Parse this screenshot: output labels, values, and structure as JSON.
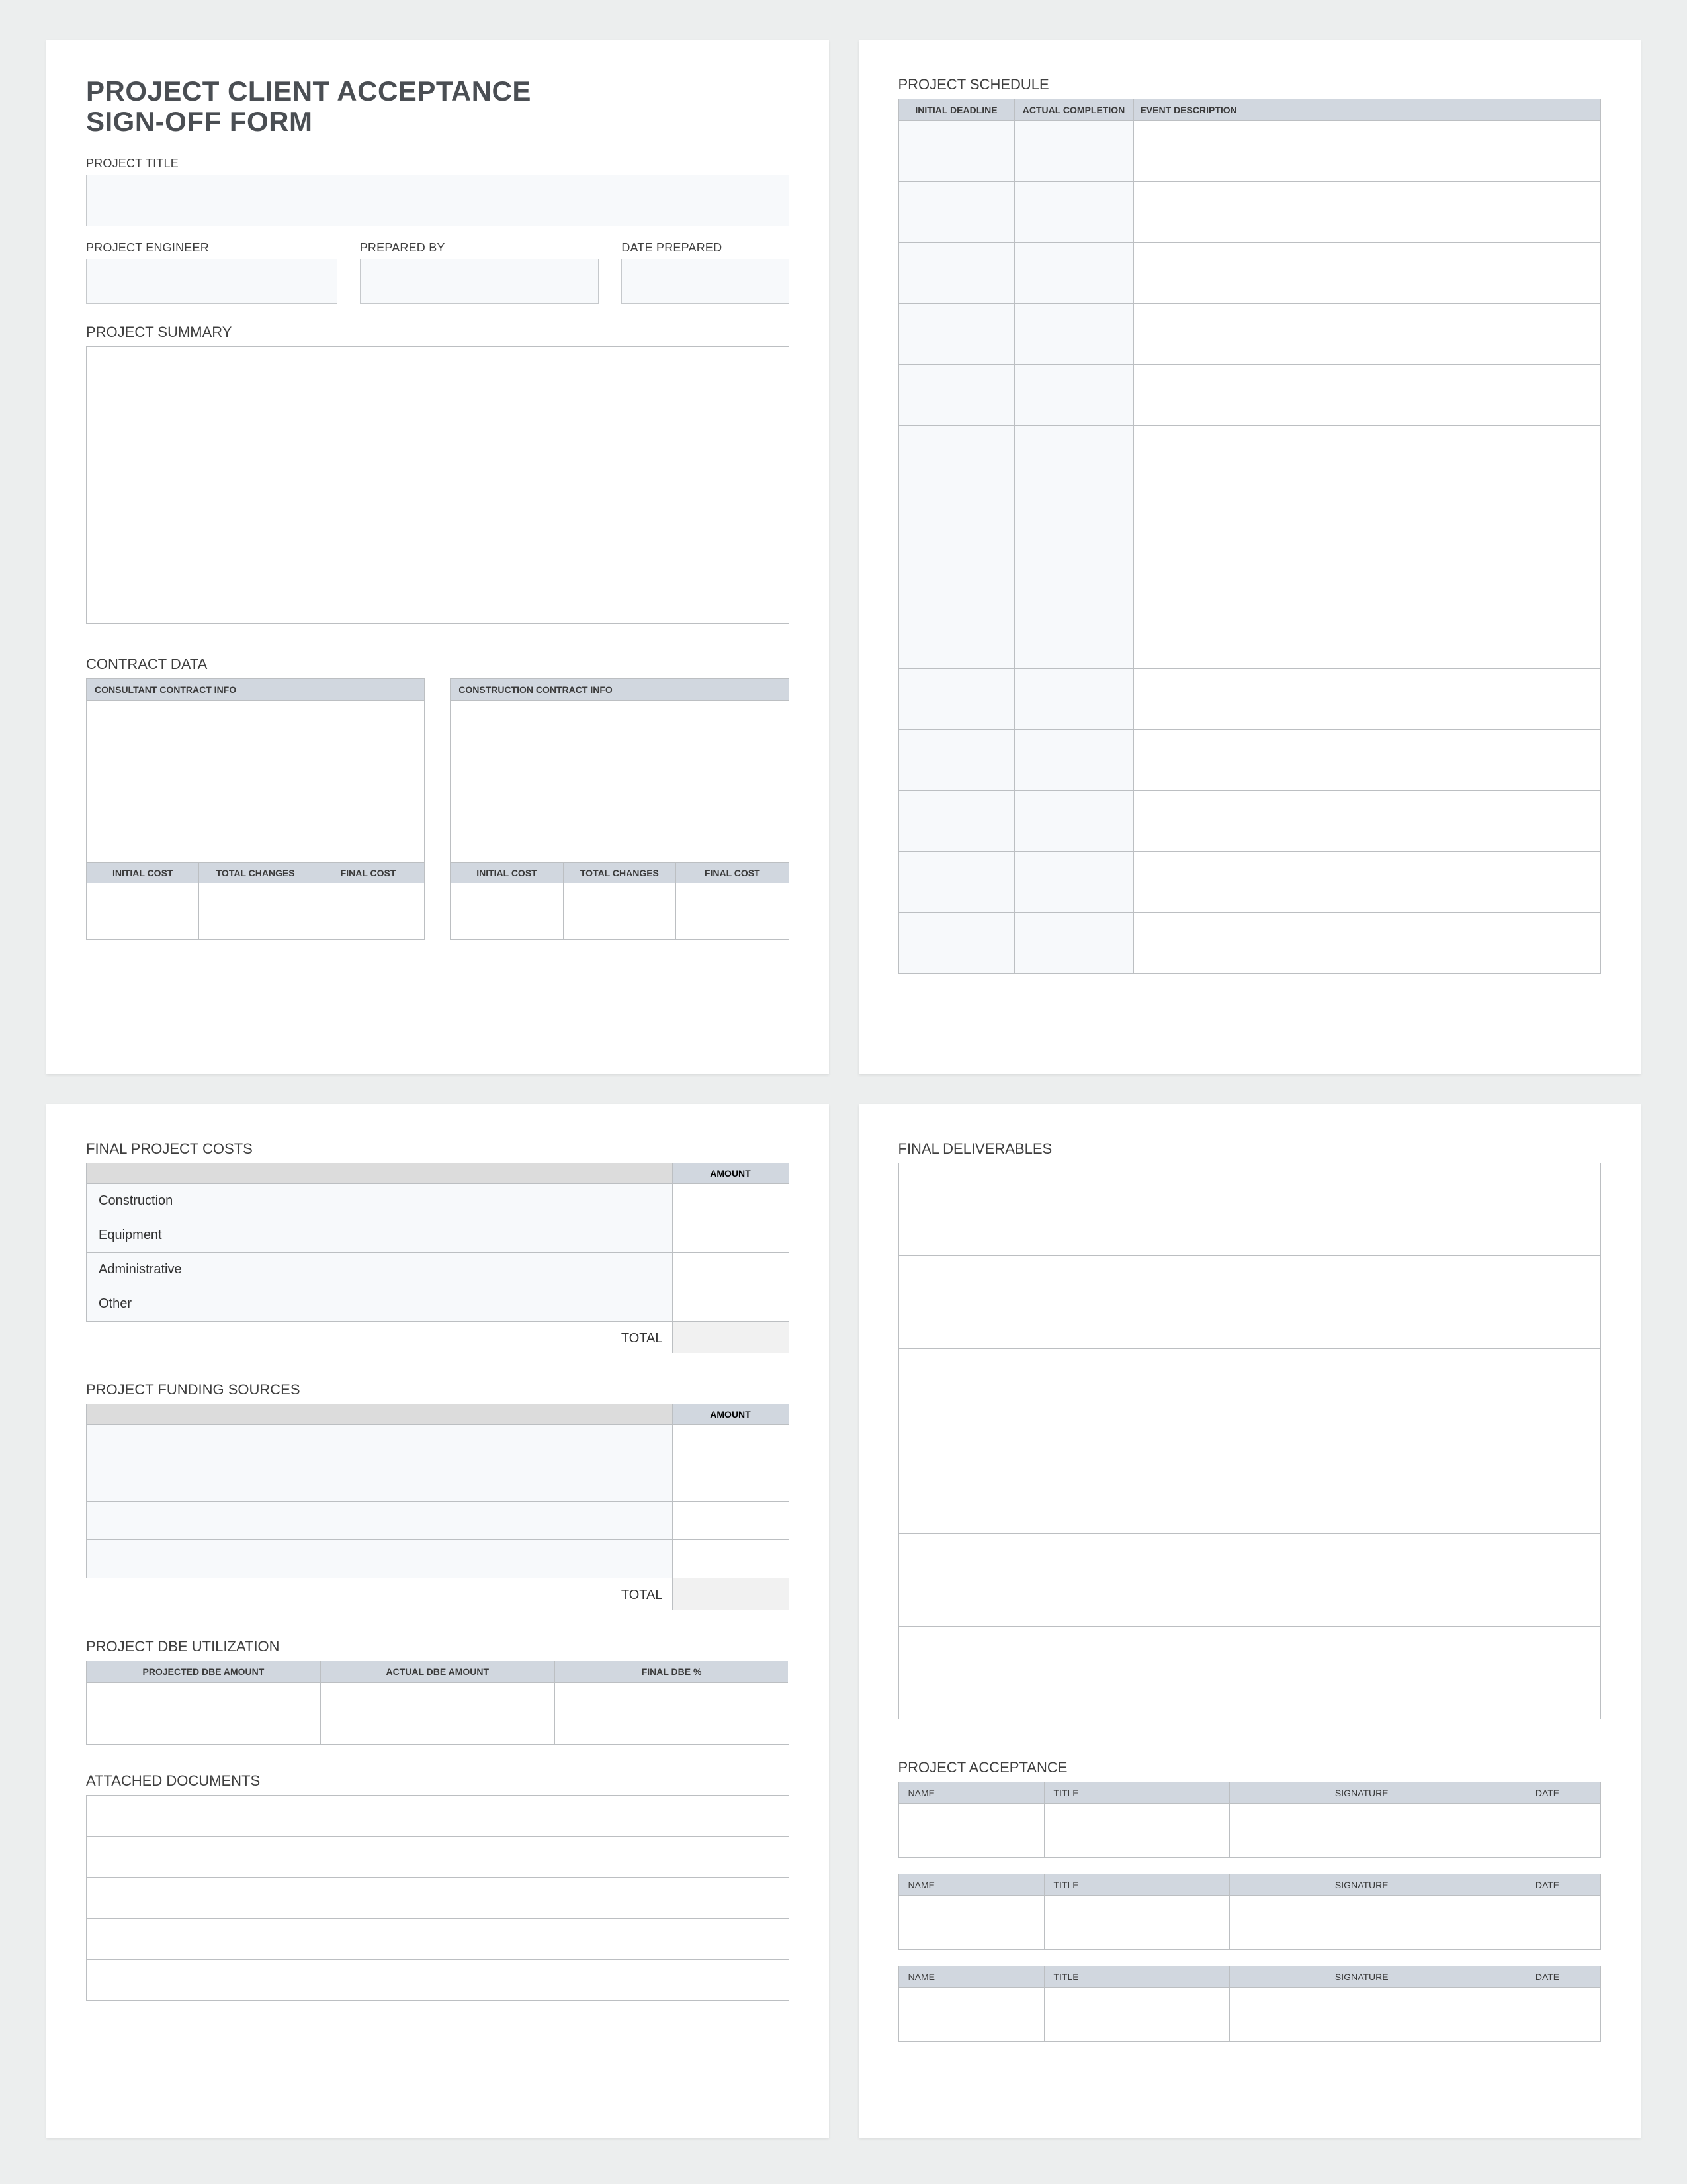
{
  "title_line1": "PROJECT CLIENT ACCEPTANCE",
  "title_line2": "SIGN-OFF FORM",
  "labels": {
    "project_title": "PROJECT TITLE",
    "project_engineer": "PROJECT ENGINEER",
    "prepared_by": "PREPARED BY",
    "date_prepared": "DATE PREPARED",
    "project_summary": "PROJECT SUMMARY",
    "contract_data": "CONTRACT DATA",
    "project_schedule": "PROJECT SCHEDULE",
    "final_project_costs": "FINAL PROJECT COSTS",
    "project_funding_sources": "PROJECT FUNDING SOURCES",
    "project_dbe_utilization": "PROJECT DBE UTILIZATION",
    "attached_documents": "ATTACHED DOCUMENTS",
    "final_deliverables": "FINAL DELIVERABLES",
    "project_acceptance": "PROJECT ACCEPTANCE",
    "total": "TOTAL"
  },
  "contract": {
    "consultant_header": "CONSULTANT CONTRACT INFO",
    "construction_header": "CONSTRUCTION CONTRACT INFO",
    "cols": [
      "INITIAL COST",
      "TOTAL CHANGES",
      "FINAL COST"
    ]
  },
  "schedule": {
    "cols": [
      "INITIAL DEADLINE",
      "ACTUAL COMPLETION",
      "EVENT DESCRIPTION"
    ],
    "row_count": 14
  },
  "costs": {
    "amount_header": "AMOUNT",
    "rows": [
      "Construction",
      "Equipment",
      "Administrative",
      "Other"
    ]
  },
  "funding": {
    "amount_header": "AMOUNT",
    "row_count": 4
  },
  "dbe": {
    "cols": [
      "PROJECTED DBE AMOUNT",
      "ACTUAL DBE AMOUNT",
      "FINAL DBE %"
    ]
  },
  "docs": {
    "row_count": 5
  },
  "deliverables": {
    "row_count": 6
  },
  "acceptance": {
    "cols": [
      "NAME",
      "TITLE",
      "SIGNATURE",
      "DATE"
    ],
    "blocks": 3
  }
}
